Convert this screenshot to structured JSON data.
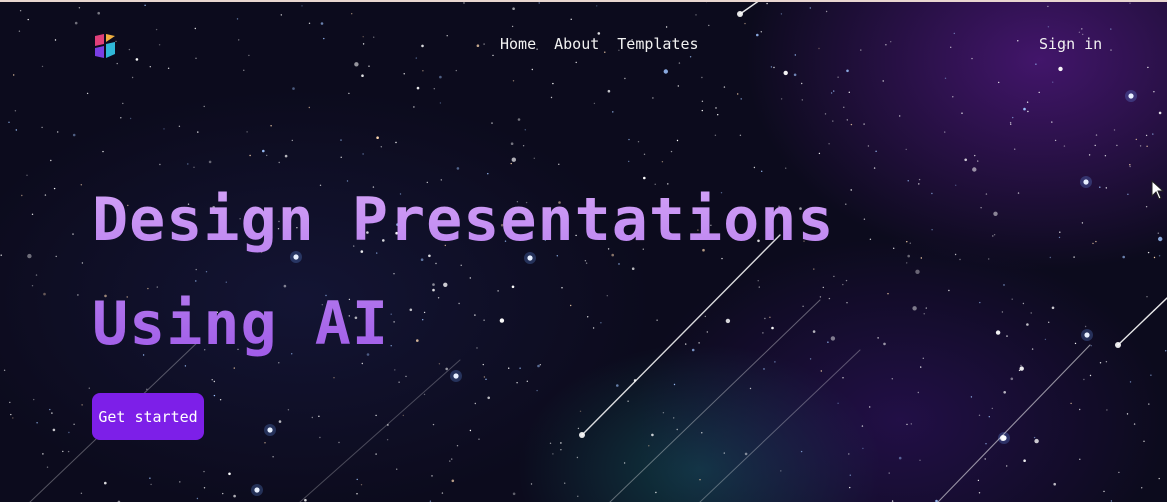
{
  "nav": {
    "logo": "logo-icon",
    "links": [
      {
        "label": "Home"
      },
      {
        "label": "About"
      },
      {
        "label": "Templates"
      }
    ],
    "sign_in": "Sign in"
  },
  "hero": {
    "title_line1": "Design Presentations",
    "title_line2": "Using AI",
    "cta_label": "Get started"
  },
  "colors": {
    "accent": "#7d1fe8",
    "title_gradient_top": "#d8a8f8",
    "title_gradient_bottom": "#9b55e6",
    "nav_text": "#f2f2f2",
    "background": "#0c0b1d"
  },
  "icons": {
    "cursor": "mouse-pointer-icon"
  }
}
